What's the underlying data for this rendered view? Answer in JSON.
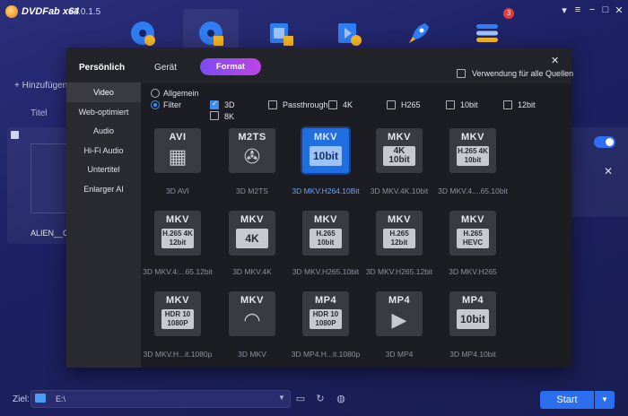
{
  "app": {
    "name": "DVDFab x64",
    "version": "12.0.1.5",
    "notification_count": "3"
  },
  "window_controls": {
    "pin": "▾",
    "menu": "≡",
    "minimize": "−",
    "maximize": "□",
    "close": "✕"
  },
  "main": {
    "add_label": "+ Hinzufügen",
    "column_title": "Titel",
    "file_name": "ALIEN__C",
    "right_close": "✕"
  },
  "bottom": {
    "dest_label": "Ziel:",
    "dest_value": "E:\\",
    "start_label": "Start"
  },
  "modal": {
    "personal_label": "Persönlich",
    "tab_device": "Gerät",
    "tab_format": "Format",
    "close": "✕",
    "apply_all": "Verwendung für alle Quellen",
    "sidebar": [
      "Video",
      "Web-optimiert",
      "Audio",
      "Hi-Fi Audio",
      "Untertitel",
      "Enlarger AI"
    ],
    "radio_all": "Allgemein",
    "radio_filter": "Filter",
    "filters": [
      "3D",
      "8K",
      "Passthrough",
      "4K",
      "H265",
      "10bit",
      "12bit"
    ],
    "tiles": [
      {
        "top": "AVI",
        "box": "",
        "caption": "3D AVI"
      },
      {
        "top": "M2TS",
        "box": "",
        "caption": "3D M2TS"
      },
      {
        "top": "MKV",
        "box": "10bit",
        "caption": "3D MKV.H264.10Bit"
      },
      {
        "top": "MKV",
        "box": "4K 10bit",
        "caption": "3D MKV.4K.10bit"
      },
      {
        "top": "MKV",
        "box": "H.265 4K 10bit",
        "caption": "3D MKV.4....65.10bit"
      },
      {
        "top": "MKV",
        "box": "H.265 4K 12bit",
        "caption": "3D MKV.4:...65.12bit"
      },
      {
        "top": "MKV",
        "box": "4K",
        "caption": "3D MKV.4K"
      },
      {
        "top": "MKV",
        "box": "H.265 10bit",
        "caption": "3D MKV.H265.10bit"
      },
      {
        "top": "MKV",
        "box": "H.265 12bit",
        "caption": "3D MKV.H265.12bit"
      },
      {
        "top": "MKV",
        "box": "H.265 HEVC",
        "caption": "3D MKV.H265"
      },
      {
        "top": "MKV",
        "box": "HDR 10 1080P",
        "caption": "3D MKV.H...it.1080p"
      },
      {
        "top": "MKV",
        "box": "",
        "caption": "3D MKV"
      },
      {
        "top": "MP4",
        "box": "HDR 10 1080P",
        "caption": "3D MP4.H...it.1080p"
      },
      {
        "top": "MP4",
        "box": "",
        "caption": "3D MP4"
      },
      {
        "top": "MP4",
        "box": "10bit",
        "caption": "3D MP4.10bit"
      }
    ]
  },
  "colors": {
    "accent": "#2b6fee",
    "format_tab_start": "#7b4df2",
    "format_tab_end": "#c043e6",
    "selected_tile": "#1f6fe0"
  }
}
